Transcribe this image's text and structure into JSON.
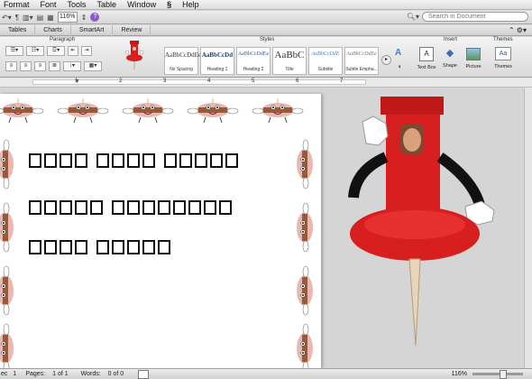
{
  "menubar": {
    "items": [
      "Format",
      "Font",
      "Tools",
      "Table",
      "Window",
      "Help"
    ]
  },
  "toolbar": {
    "zoom_value": "116%",
    "search_placeholder": "Search in Document"
  },
  "ribbon_tabs": [
    "Tables",
    "Charts",
    "SmartArt",
    "Review"
  ],
  "ribbon": {
    "groups": {
      "paragraph": "Paragraph",
      "styles": "Styles",
      "insert": "Insert",
      "themes": "Themes"
    },
    "styles": [
      {
        "sample": "AaBbCcDdEe",
        "label": "No Spacing"
      },
      {
        "sample": "AaBbCcDd",
        "label": "Heading 1"
      },
      {
        "sample": "AaBbCcDdEe",
        "label": "Heading 2"
      },
      {
        "sample": "AaBbC",
        "label": "Title"
      },
      {
        "sample": "AaBbCcDdE",
        "label": "Subtitle"
      },
      {
        "sample": "AaBbCcDdEe",
        "label": "Subtle Empha..."
      }
    ],
    "insert_items": [
      "Text Box",
      "Shape",
      "Picture"
    ],
    "themes_item": "Themes",
    "themes_sample": "Aa"
  },
  "ruler": {
    "labels": [
      "1",
      "2",
      "3",
      "4",
      "5",
      "6",
      "7"
    ]
  },
  "document": {
    "lines": [
      {
        "words": [
          4,
          4,
          5
        ]
      },
      {
        "words": [
          5,
          8
        ]
      },
      {
        "words": [
          4,
          5
        ]
      }
    ]
  },
  "status": {
    "sec_label": "ec",
    "sec_value": "1",
    "pages_label": "Pages:",
    "pages_value": "1 of 1",
    "words_label": "Words:",
    "words_value": "0 of 0",
    "zoom": "116%"
  },
  "colors": {
    "pushpin_red": "#d81f1f",
    "help_purple": "#8a5bc7",
    "glyph_black": "#111111"
  }
}
